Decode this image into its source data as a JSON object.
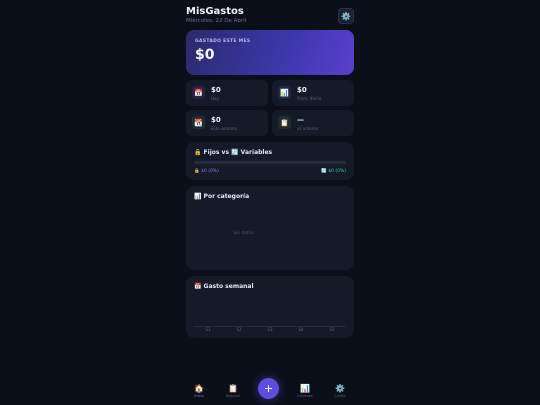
{
  "header": {
    "title": "MisGastos",
    "date": "Miércoles, 22 De Abril",
    "settings_icon": "gear-icon"
  },
  "hero": {
    "label": "GASTADO ESTE MES",
    "value": "$0"
  },
  "stats": [
    {
      "value": "$0",
      "label": "Hoy",
      "icon": "📅",
      "icon_name": "calendar-icon"
    },
    {
      "value": "$0",
      "label": "Prom. diario",
      "icon": "📊",
      "icon_name": "bar-chart-icon"
    },
    {
      "value": "$0",
      "label": "Esta semana",
      "icon": "📆",
      "icon_name": "calendar-week-icon"
    },
    {
      "value": "—",
      "label": "vs anterior",
      "icon": "📋",
      "icon_name": "clipboard-icon"
    }
  ],
  "fixed_vs_variable": {
    "title": "🔒 Fijos vs 🔄 Variables",
    "fixed": "🔒 $0 (0%)",
    "variable": "🔄 $0 (0%)"
  },
  "by_category": {
    "title": "📊 Por categoría",
    "empty": "Sin datos"
  },
  "weekly": {
    "title": "📅 Gasto semanal",
    "ticks": [
      "S1",
      "S2",
      "S3",
      "S4",
      "S5"
    ]
  },
  "nav": {
    "items": [
      {
        "label": "Inicio",
        "icon": "🏠",
        "icon_name": "home-icon"
      },
      {
        "label": "Historial",
        "icon": "📋",
        "icon_name": "history-icon"
      },
      {
        "label": "Informes",
        "icon": "📊",
        "icon_name": "reports-icon"
      },
      {
        "label": "Config",
        "icon": "⚙️",
        "icon_name": "gear-icon"
      }
    ],
    "add": "+"
  },
  "colors": {
    "background": "#0b0f1a",
    "card": "#151a28",
    "accent": "#5b4de0",
    "fixed": "#8b7cf6",
    "variable": "#34d399"
  }
}
